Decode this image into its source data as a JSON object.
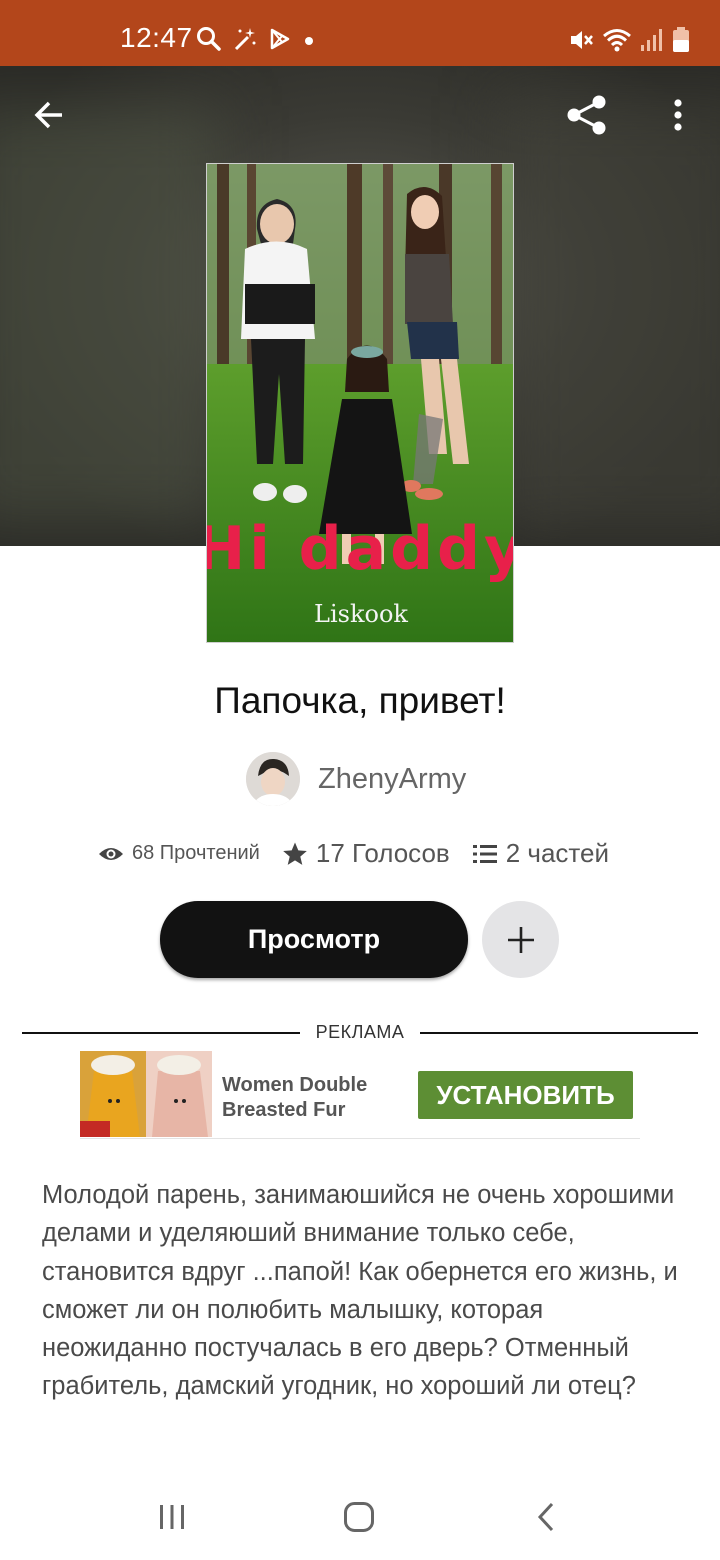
{
  "status_bar": {
    "time": "12:47",
    "left_icons": [
      "search-icon",
      "magic-wand-icon",
      "play-store-icon",
      "dot-icon"
    ],
    "right_icons": [
      "mute-icon",
      "wifi-icon",
      "signal-icon",
      "battery-icon"
    ],
    "color": "#b3461b"
  },
  "toolbar": {
    "back_icon": "arrow-left-icon",
    "share_icon": "share-icon",
    "more_icon": "more-vertical-icon"
  },
  "cover": {
    "title_text": "Hi daddy",
    "author_text": "Liskook"
  },
  "story": {
    "title": "Папочка, привет!",
    "author": "ZhenyArmy",
    "reads_label": "68 Прочтений",
    "votes_label": "17 Голосов",
    "parts_label": "2 частей"
  },
  "actions": {
    "read_label": "Просмотр",
    "add_icon": "plus-icon"
  },
  "ad": {
    "label": "РЕКЛАМА",
    "headline": "Women Double Breasted Fur",
    "cta_label": "УСТАНОВИТЬ",
    "cta_color": "#5d8e34"
  },
  "description": "Молодой парень, занимаюшийся не очень хорошими делами и уделяюший внимание только себе, становится вдруг ...папой! Как обернется его жизнь, и сможет ли он полюбить малышку, которая неожиданно постучалась в его дверь? Отменный грабитель, дамский угодник, но хороший ли отец?",
  "nav_bar": {
    "recent_icon": "recent-apps-icon",
    "home_icon": "home-icon",
    "back_icon": "back-chevron-icon"
  }
}
